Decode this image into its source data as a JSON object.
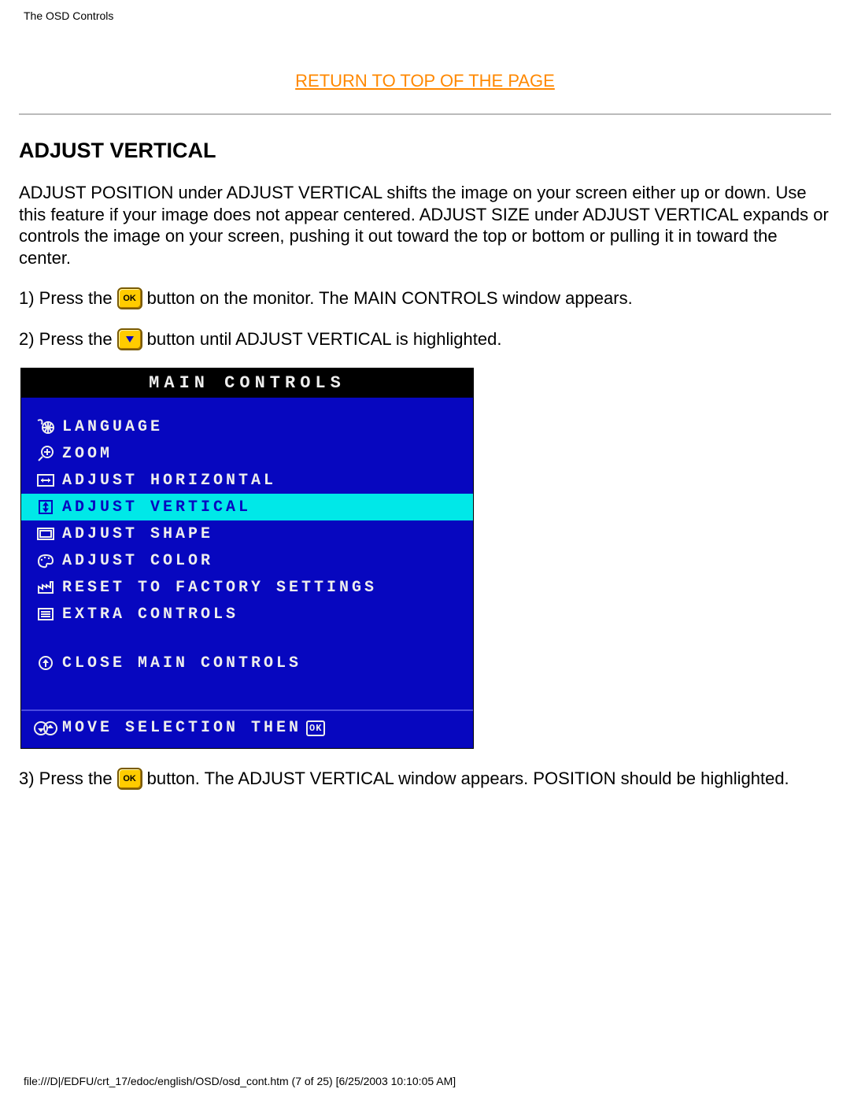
{
  "header": {
    "label": "The OSD Controls"
  },
  "returnLink": "RETURN TO TOP OF THE PAGE",
  "section": {
    "title": "ADJUST VERTICAL"
  },
  "paragraph": "ADJUST POSITION under ADJUST VERTICAL shifts the image on your screen either up or down. Use this feature if your image does not appear centered. ADJUST SIZE under ADJUST VERTICAL expands or controls the image on your screen, pushing it out toward the top or bottom or pulling it in toward the center.",
  "steps": {
    "s1a": "1) Press the",
    "s1b": "button on the monitor. The MAIN CONTROLS window appears.",
    "s2a": "2) Press the",
    "s2b": "button until ADJUST VERTICAL is highlighted.",
    "s3a": "3) Press the",
    "s3b": "button. The ADJUST VERTICAL window appears. POSITION should be highlighted."
  },
  "buttons": {
    "ok": "OK"
  },
  "osd": {
    "title": "MAIN CONTROLS",
    "items": [
      {
        "label": "LANGUAGE",
        "icon": "language"
      },
      {
        "label": "ZOOM",
        "icon": "zoom"
      },
      {
        "label": "ADJUST HORIZONTAL",
        "icon": "horiz"
      },
      {
        "label": "ADJUST VERTICAL",
        "icon": "vert",
        "highlight": true
      },
      {
        "label": "ADJUST SHAPE",
        "icon": "shape"
      },
      {
        "label": "ADJUST COLOR",
        "icon": "color"
      },
      {
        "label": "RESET TO FACTORY SETTINGS",
        "icon": "factory"
      },
      {
        "label": "EXTRA CONTROLS",
        "icon": "extra"
      }
    ],
    "close": {
      "label": "CLOSE MAIN CONTROLS",
      "icon": "close"
    },
    "hint": {
      "label": "MOVE SELECTION THEN",
      "icon": "updown",
      "ok": "OK"
    }
  },
  "footer": "file:///D|/EDFU/crt_17/edoc/english/OSD/osd_cont.htm (7 of 25) [6/25/2003 10:10:05 AM]"
}
